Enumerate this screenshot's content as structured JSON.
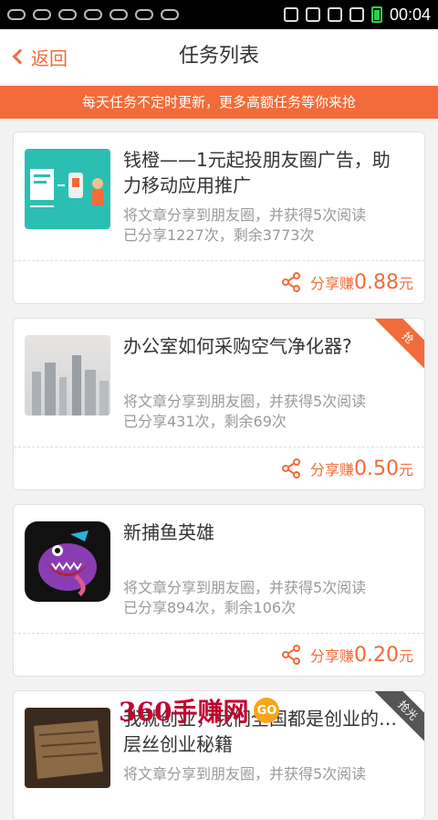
{
  "status": {
    "time": "00:04"
  },
  "header": {
    "back_label": "返回",
    "title": "任务列表"
  },
  "banner": {
    "text": "每天任务不定时更新，更多高额任务等你来抢"
  },
  "tasks": [
    {
      "title": "钱橙——1元起投朋友圈广告，助力移动应用推广",
      "desc_line1": "将文章分享到朋友圈，并获得5次阅读",
      "desc_line2": "已分享1227次，剩余3773次",
      "share_label": "分享赚",
      "price": "0.88",
      "unit": "元",
      "badge": ""
    },
    {
      "title": "办公室如何采购空气净化器?",
      "desc_line1": "将文章分享到朋友圈，并获得5次阅读",
      "desc_line2": "已分享431次，剩余69次",
      "share_label": "分享赚",
      "price": "0.50",
      "unit": "元",
      "badge": "抢"
    },
    {
      "title": "新捕鱼英雄",
      "desc_line1": "将文章分享到朋友圈，并获得5次阅读",
      "desc_line2": "已分享894次，剩余106次",
      "share_label": "分享赚",
      "price": "0.20",
      "unit": "元",
      "badge": ""
    },
    {
      "title": "我就创业，我们全国都是创业的… 层丝创业秘籍",
      "desc_line1": "将文章分享到朋友圈，并获得5次阅读",
      "badge": "抢光"
    }
  ],
  "watermark": {
    "text": "360手赚网",
    "go": "GO"
  }
}
